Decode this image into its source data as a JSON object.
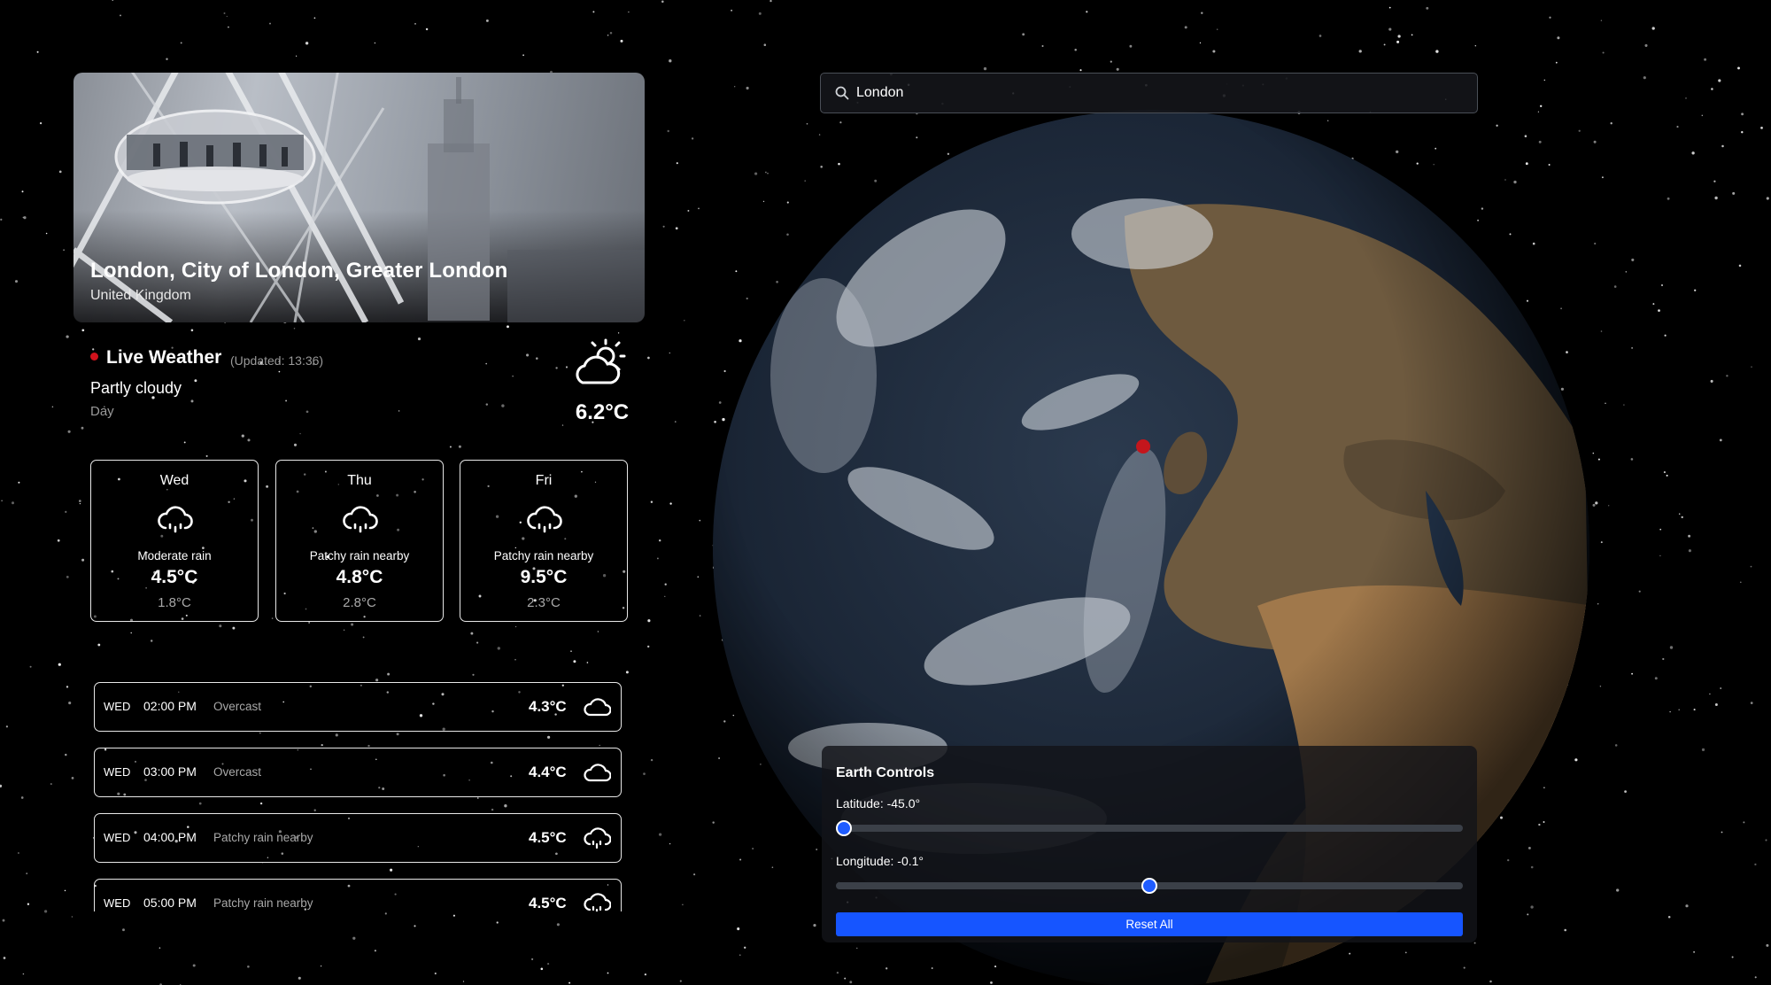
{
  "location": {
    "title": "London, City of London, Greater London",
    "country": "United Kingdom"
  },
  "live": {
    "title": "Live Weather",
    "updated": "(Updated: 13:36)",
    "condition": "Partly cloudy",
    "period": "Day",
    "temperature": "6.2°C",
    "icon": "partly-cloudy-day-icon"
  },
  "forecast": [
    {
      "day": "Wed",
      "condition": "Moderate rain",
      "max": "4.5°C",
      "min": "1.8°C",
      "icon": "rain-cloud-icon"
    },
    {
      "day": "Thu",
      "condition": "Patchy rain nearby",
      "max": "4.8°C",
      "min": "2.8°C",
      "icon": "rain-cloud-icon"
    },
    {
      "day": "Fri",
      "condition": "Patchy rain nearby",
      "max": "9.5°C",
      "min": "2.3°C",
      "icon": "rain-cloud-icon"
    }
  ],
  "hourly": [
    {
      "day": "WED",
      "time": "02:00 PM",
      "condition": "Overcast",
      "temp": "4.3°C",
      "icon": "cloud-icon"
    },
    {
      "day": "WED",
      "time": "03:00 PM",
      "condition": "Overcast",
      "temp": "4.4°C",
      "icon": "cloud-icon"
    },
    {
      "day": "WED",
      "time": "04:00 PM",
      "condition": "Patchy rain nearby",
      "temp": "4.5°C",
      "icon": "rain-cloud-icon"
    },
    {
      "day": "WED",
      "time": "05:00 PM",
      "condition": "Patchy rain nearby",
      "temp": "4.5°C",
      "icon": "rain-cloud-icon"
    }
  ],
  "search": {
    "value": "London",
    "icon": "search-icon"
  },
  "controls": {
    "title": "Earth Controls",
    "latitude_label": "Latitude: -45.0°",
    "longitude_label": "Longitude: -0.1°",
    "latitude_value": -45.0,
    "longitude_value": -0.1,
    "reset_label": "Reset All"
  },
  "colors": {
    "background": "#000000",
    "live_dot": "#d1121c",
    "accent": "#1655ff",
    "location_marker": "#c4161c"
  }
}
